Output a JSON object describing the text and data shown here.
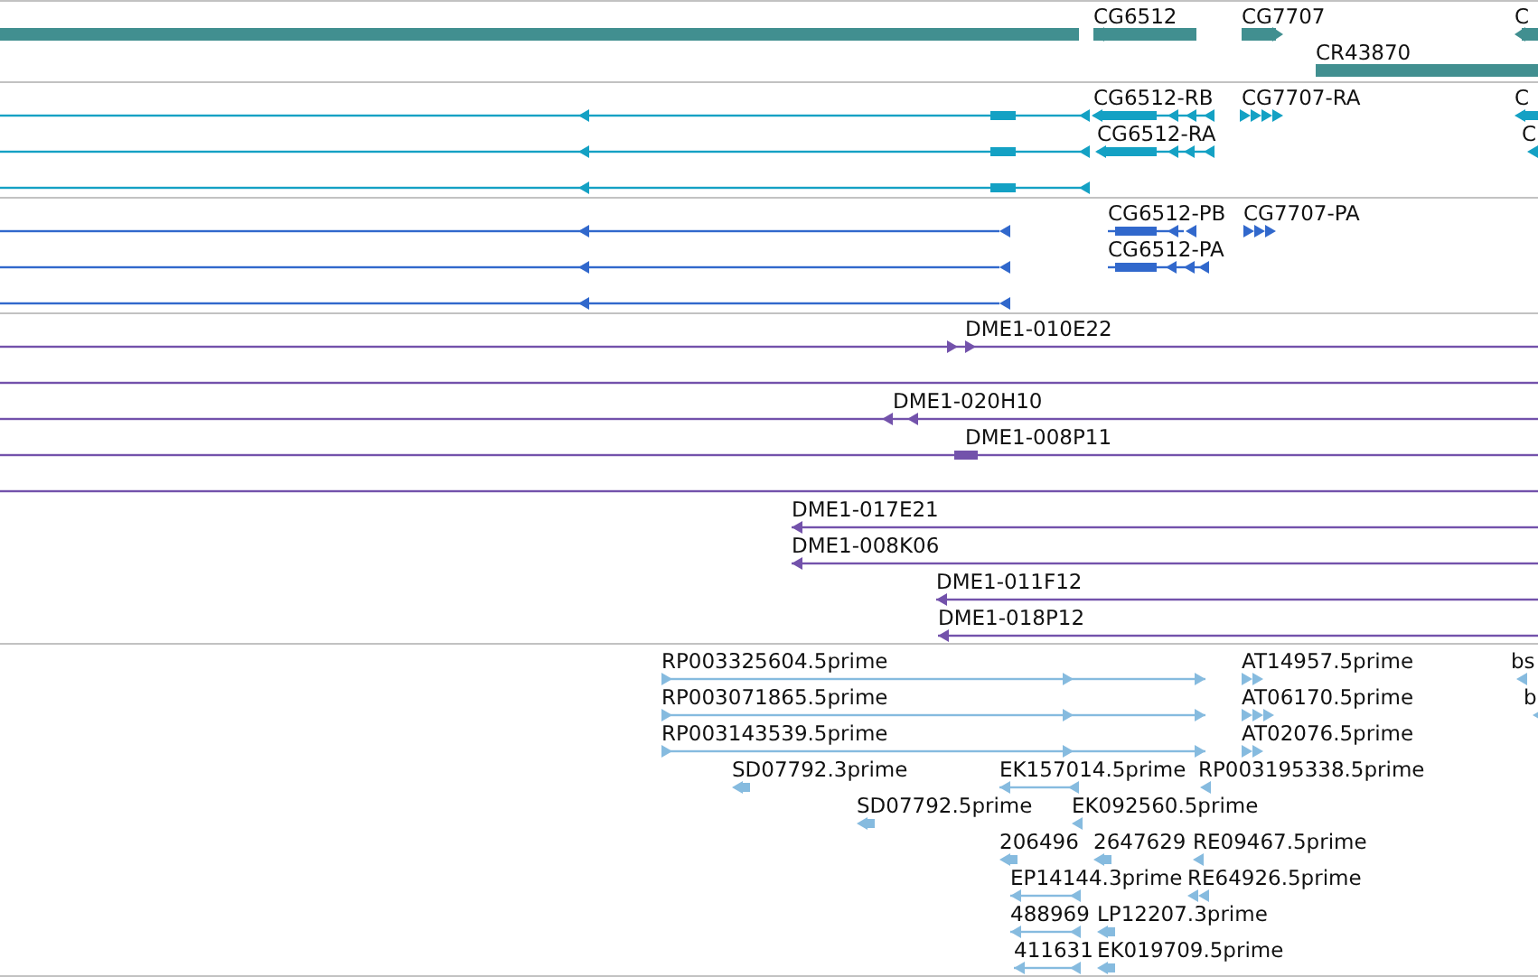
{
  "tracks": [
    {
      "kind": "genes",
      "color": "#418f90",
      "features": [
        {
          "kind": "bar"
        },
        {
          "kind": "bar",
          "label": "CG6512",
          "reverse": true
        },
        {
          "kind": "bar",
          "label": "CG7707",
          "reverse": false
        },
        {
          "kind": "bar",
          "label": "C",
          "reverse": true
        },
        {
          "kind": "bar",
          "label": "CR43870"
        }
      ]
    },
    {
      "kind": "transcripts",
      "color": "#14a1c4",
      "features": [
        {
          "kind": "line",
          "reverse": true
        },
        {
          "kind": "line",
          "reverse": true
        },
        {
          "kind": "line",
          "reverse": true
        },
        {
          "kind": "line",
          "label": "CG6512-RB",
          "reverse": true
        },
        {
          "kind": "line",
          "label": "CG6512-RA",
          "reverse": true
        },
        {
          "kind": "bar",
          "label": "CG7707-RA",
          "reverse": false
        },
        {
          "kind": "bar",
          "label": "C",
          "reverse": true
        },
        {
          "kind": "bar",
          "label": "C",
          "reverse": true
        }
      ]
    },
    {
      "kind": "proteins",
      "color": "#3168cc",
      "features": [
        {
          "kind": "line",
          "reverse": true
        },
        {
          "kind": "line",
          "reverse": true
        },
        {
          "kind": "line",
          "reverse": true
        },
        {
          "kind": "line",
          "label": "CG6512-PB",
          "reverse": true
        },
        {
          "kind": "line",
          "label": "CG6512-PA",
          "reverse": true
        },
        {
          "kind": "bar",
          "label": "CG7707-PA",
          "reverse": false
        }
      ]
    },
    {
      "kind": "clones",
      "color": "#7352ab",
      "features": [
        {
          "kind": "line",
          "label": "DME1-010E22",
          "reverse": false
        },
        {
          "kind": "line"
        },
        {
          "kind": "line",
          "label": "DME1-020H10",
          "reverse": true
        },
        {
          "kind": "line",
          "label": "DME1-008P11"
        },
        {
          "kind": "line"
        },
        {
          "kind": "line",
          "label": "DME1-017E21",
          "reverse": true
        },
        {
          "kind": "line",
          "label": "DME1-008K06",
          "reverse": true
        },
        {
          "kind": "line",
          "label": "DME1-011F12",
          "reverse": true
        },
        {
          "kind": "line",
          "label": "DME1-018P12",
          "reverse": true
        }
      ]
    },
    {
      "kind": "ests",
      "color": "#86bbdf",
      "features": [
        {
          "kind": "line",
          "label": "RP003325604.5prime",
          "reverse": false
        },
        {
          "kind": "line",
          "label": "RP003071865.5prime",
          "reverse": false
        },
        {
          "kind": "line",
          "label": "RP003143539.5prime",
          "reverse": false
        },
        {
          "kind": "bar",
          "label": "AT14957.5prime",
          "reverse": false
        },
        {
          "kind": "bar",
          "label": "AT06170.5prime",
          "reverse": false
        },
        {
          "kind": "bar",
          "label": "AT02076.5prime",
          "reverse": false
        },
        {
          "kind": "bar",
          "label": "bs",
          "reverse": true
        },
        {
          "kind": "bar",
          "label": "b",
          "reverse": true
        },
        {
          "kind": "bar",
          "label": "SD07792.3prime",
          "reverse": true
        },
        {
          "kind": "line",
          "label": "EK157014.5prime",
          "reverse": true
        },
        {
          "kind": "bar",
          "label": "RP003195338.5prime",
          "reverse": true
        },
        {
          "kind": "bar",
          "label": "SD07792.5prime",
          "reverse": true
        },
        {
          "kind": "bar",
          "label": "EK092560.5prime",
          "reverse": true
        },
        {
          "kind": "bar",
          "label": "206496",
          "reverse": true
        },
        {
          "kind": "bar",
          "label": "2647629",
          "reverse": true
        },
        {
          "kind": "bar",
          "label": "RE09467.5prime",
          "reverse": true
        },
        {
          "kind": "line",
          "label": "EP14144.3prime",
          "reverse": true
        },
        {
          "kind": "bar",
          "label": "RE64926.5prime",
          "reverse": true
        },
        {
          "kind": "line",
          "label": "488969",
          "reverse": true
        },
        {
          "kind": "bar",
          "label": "LP12207.3prime",
          "reverse": true
        },
        {
          "kind": "line",
          "label": "411631",
          "reverse": true
        },
        {
          "kind": "bar",
          "label": "EK019709.5prime",
          "reverse": true
        }
      ]
    }
  ]
}
